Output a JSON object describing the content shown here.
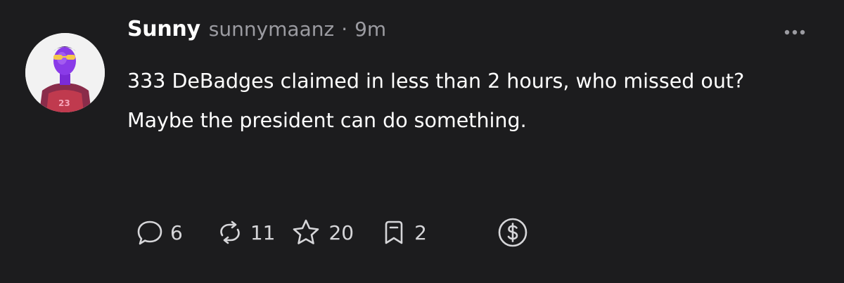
{
  "post": {
    "author_name": "Sunny",
    "handle": "sunnymaanz",
    "separator": "·",
    "time": "9m",
    "body": {
      "line1": "333 DeBadges claimed in less than 2 hours, who missed out?",
      "line2": "Maybe the president can do something."
    },
    "actions": {
      "replies": "6",
      "reposts": "11",
      "likes": "20",
      "bookmarks": "2"
    },
    "icons": [
      "more-icon",
      "reply-icon",
      "repost-icon",
      "star-icon",
      "bookmark-icon",
      "dollar-tip-icon"
    ]
  },
  "colors": {
    "background": "#1c1c1e",
    "primary_text": "#ffffff",
    "secondary_text": "#9b9ba1",
    "icon": "#d6d6d9"
  }
}
